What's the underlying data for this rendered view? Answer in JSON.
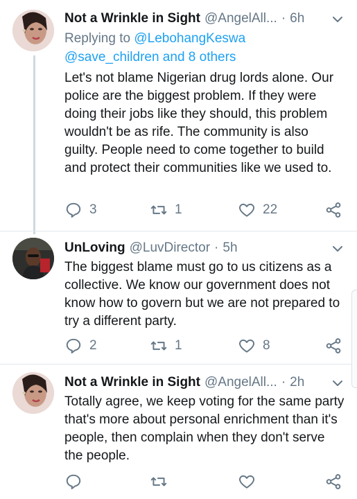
{
  "tweets": [
    {
      "name": "Not a Wrinkle in Sight",
      "handle": "@AngelAll...",
      "sep": "·",
      "time": "6h",
      "reply_prefix": "Replying to",
      "reply_line1": "@LebohangKeswa",
      "reply_line2": "@save_children and 8 others",
      "text": "Let's not blame Nigerian drug lords alone. Our police are the biggest problem. If they were doing their jobs like they should, this problem wouldn't be as rife. The community is also guilty. People need to come together to build and protect their communities like we used to.",
      "replies": "3",
      "retweets": "1",
      "likes": "22"
    },
    {
      "name": "UnLoving",
      "handle": "@LuvDirector",
      "sep": "·",
      "time": "5h",
      "text": "The biggest blame must go to us citizens as a collective. We know our government does not know how to govern but we are not prepared to try a different party.",
      "replies": "2",
      "retweets": "1",
      "likes": "8"
    },
    {
      "name": "Not a Wrinkle in Sight",
      "handle": "@AngelAll...",
      "sep": "·",
      "time": "2h",
      "text": "Totally agree, we keep voting for the same party that's more about personal enrichment than it's people, then complain when they don't serve the people.",
      "replies": "",
      "retweets": "",
      "likes": ""
    }
  ],
  "icons": {
    "reply": "reply-icon",
    "retweet": "retweet-icon",
    "like": "heart-icon",
    "share": "share-icon",
    "more": "chevron-down-icon"
  },
  "colors": {
    "text": "#14171a",
    "secondary": "#657786",
    "link": "#1da1f2",
    "divider": "#e1e8ed"
  }
}
